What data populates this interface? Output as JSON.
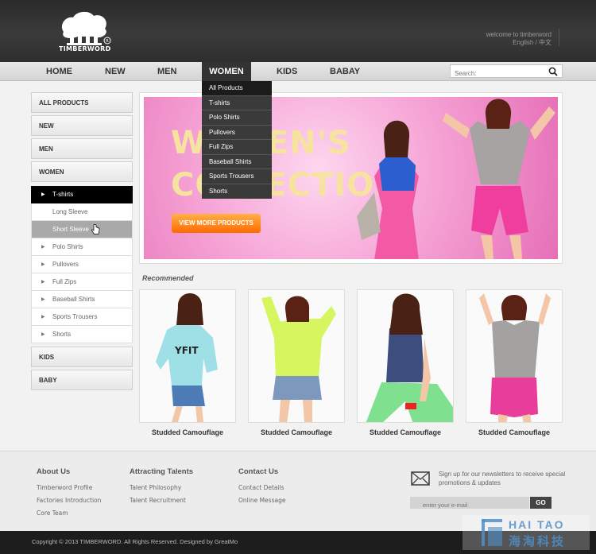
{
  "header": {
    "logo_text": "TIMBERWORD",
    "welcome": "welcome to timberword",
    "lang": "English / 中文"
  },
  "nav": {
    "items": [
      "HOME",
      "NEW",
      "MEN",
      "WOMEN",
      "KIDS",
      "BABAY"
    ],
    "active": "WOMEN",
    "search_placeholder": "Search:"
  },
  "dropdown": {
    "items": [
      "All Products",
      "T-shirts",
      "Polo Shirts",
      "Pullovers",
      "Full Zips",
      "Baseball Shirts",
      "Sports Trousers",
      "Shorts"
    ]
  },
  "sidebar": {
    "all_products": "ALL PRODUCTS",
    "new": "NEW",
    "men": "MEN",
    "women": "WOMEN",
    "tshirts": "T-shirts",
    "long_sleeve": "Long Sleeve",
    "short_sleeve": "Short Sleeve",
    "polo": "Polo Shirts",
    "pullovers": "Pullovers",
    "full_zips": "Full Zips",
    "baseball": "Baseball Shirts",
    "sports": "Sports Trousers",
    "shorts": "Shorts",
    "kids": "KIDS",
    "baby": "BABY"
  },
  "banner": {
    "line1": "WOMEN'S",
    "line2": "COLLECTION",
    "button": "VIEW MORE PRODUCTS"
  },
  "recommended": {
    "title": "Recommended",
    "products": [
      "Studded Camouflage",
      "Studded Camouflage",
      "Studded Camouflage",
      "Studded Camouflage"
    ]
  },
  "footer": {
    "about_title": "About Us",
    "about_links": [
      "Timberword Profile",
      "Factories Introduction",
      "Core Team"
    ],
    "talents_title": "Attracting Talents",
    "talents_links": [
      "Talent Philosophy",
      "Talent Recruitment"
    ],
    "contact_title": "Contact Us",
    "contact_links": [
      "Contact Details",
      "Online Message"
    ],
    "newsletter": "Sign up for our newsletters to receive special promotions & updates",
    "email_placeholder": "enter your e-mail",
    "go": "GO",
    "copyright": "Copyright © 2013 TIMBERWORD. All Rights Reserved.  Designed by GreatMo"
  },
  "watermark": {
    "line1": "HAI TAO",
    "line2": "海淘科技"
  },
  "colors": {
    "header_bg": "#333333",
    "nav_active": "#333333",
    "banner_pink": "#f6a5d6",
    "button_orange": "#ff6a00"
  }
}
